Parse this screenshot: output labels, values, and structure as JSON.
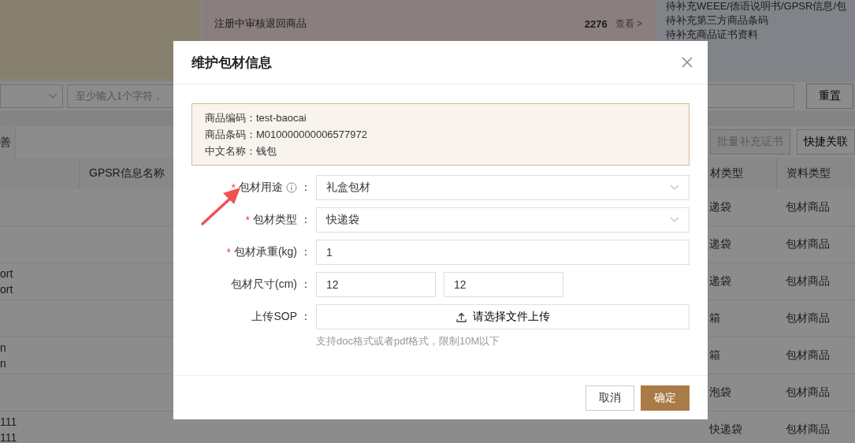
{
  "background": {
    "summary_cards": [
      {
        "kind": "blank"
      },
      {
        "kind": "stats",
        "lines": [
          {
            "label": "注册中审核退回商品",
            "count": "2276",
            "link": "查看 >"
          }
        ]
      },
      {
        "kind": "todo",
        "lines": [
          {
            "label": "待补充WEEE/德语说明书/GPSR信息/包"
          },
          {
            "label": "待补充第三方商品条码"
          },
          {
            "label": "待补充商品证书资料"
          }
        ]
      }
    ],
    "filter": {
      "search_placeholder": "至少输入1个字符，",
      "reset_button": "重置"
    },
    "tab": "善",
    "toolbar_buttons": [
      {
        "label": "批量补充证书",
        "disabled": true
      },
      {
        "label": "快捷关联",
        "disabled": false
      }
    ],
    "table": {
      "columns": [
        "",
        "GPSR信息名称",
        "材类型",
        "资料类型"
      ],
      "rows": [
        {
          "column_1": [],
          "package_type": "递袋",
          "data_type": "包材商品"
        },
        {
          "column_1": [],
          "package_type": "递袋",
          "data_type": "包材商品"
        },
        {
          "column_1": [
            "ort",
            "ort"
          ],
          "package_type": "递袋",
          "data_type": "包材商品"
        },
        {
          "column_1": [],
          "package_type": "箱",
          "data_type": "包材商品"
        },
        {
          "column_1": [
            "n",
            "n"
          ],
          "package_type": "箱",
          "data_type": "包材商品"
        },
        {
          "column_1": [],
          "package_type": "泡袋",
          "data_type": "包材商品"
        },
        {
          "column_1": [
            "111",
            "111"
          ],
          "package_type": "快递袋",
          "data_type": "包材商品"
        }
      ]
    }
  },
  "dialog": {
    "title": "维护包材信息",
    "info": [
      {
        "label": "商品编码：",
        "value": "test-baocai"
      },
      {
        "label": "商品条码：",
        "value": "M010000000006577972"
      },
      {
        "label": "中文名称：",
        "value": "钱包"
      }
    ],
    "fields": [
      {
        "kind": "select",
        "required_mark": "*",
        "label": "包材用途",
        "info_icon": true,
        "colon": "：",
        "values": [
          "礼盒包材"
        ]
      },
      {
        "kind": "select",
        "required_mark": "*",
        "label": "包材类型",
        "colon": "：",
        "values": [
          "快递袋"
        ]
      },
      {
        "kind": "input",
        "required_mark": "*",
        "label": "包材承重(kg)",
        "colon": "：",
        "values": [
          "1"
        ]
      },
      {
        "kind": "dimensions",
        "label": "包材尺寸(cm)",
        "colon": "：",
        "values": [
          "12",
          "12"
        ]
      },
      {
        "kind": "upload",
        "label": "上传SOP",
        "colon": "：",
        "values": [
          "请选择文件上传"
        ],
        "hint": "支持doc格式或者pdf格式，限制10M以下"
      }
    ],
    "buttons": [
      {
        "label": "取消",
        "primary": false
      },
      {
        "label": "确定",
        "primary": true
      }
    ]
  }
}
